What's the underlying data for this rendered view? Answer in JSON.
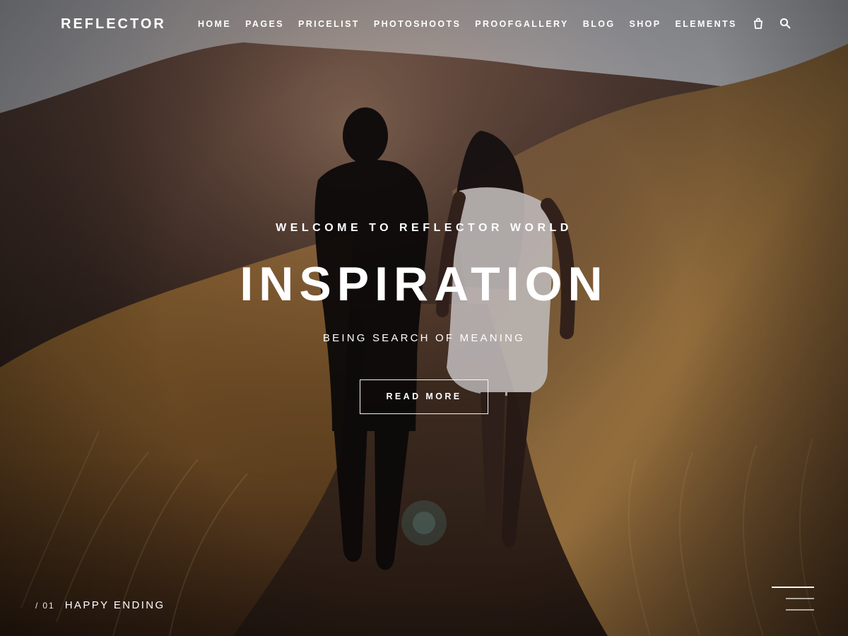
{
  "header": {
    "logo": "REFLECTOR",
    "nav": [
      "HOME",
      "PAGES",
      "PRICELIST",
      "PHOTOSHOOTS",
      "PROOFGALLERY",
      "BLOG",
      "SHOP",
      "ELEMENTS"
    ],
    "icons": {
      "cart": "shopping-bag-icon",
      "search": "search-icon"
    }
  },
  "hero": {
    "kicker": "WELCOME TO REFLECTOR WORLD",
    "headline": "INSPIRATION",
    "subline": "BEING SEARCH OF MEANING",
    "cta_label": "READ MORE"
  },
  "slider": {
    "slash": "/",
    "index": "01",
    "title": "HAPPY ENDING"
  },
  "menu_toggle": {
    "icon": "hamburger-menu-icon"
  },
  "colors": {
    "text": "#ffffff",
    "sky": "#c9ccd4",
    "hill_dark": "#2a1f18",
    "grass": "#a07a40",
    "path": "#4a3526"
  }
}
